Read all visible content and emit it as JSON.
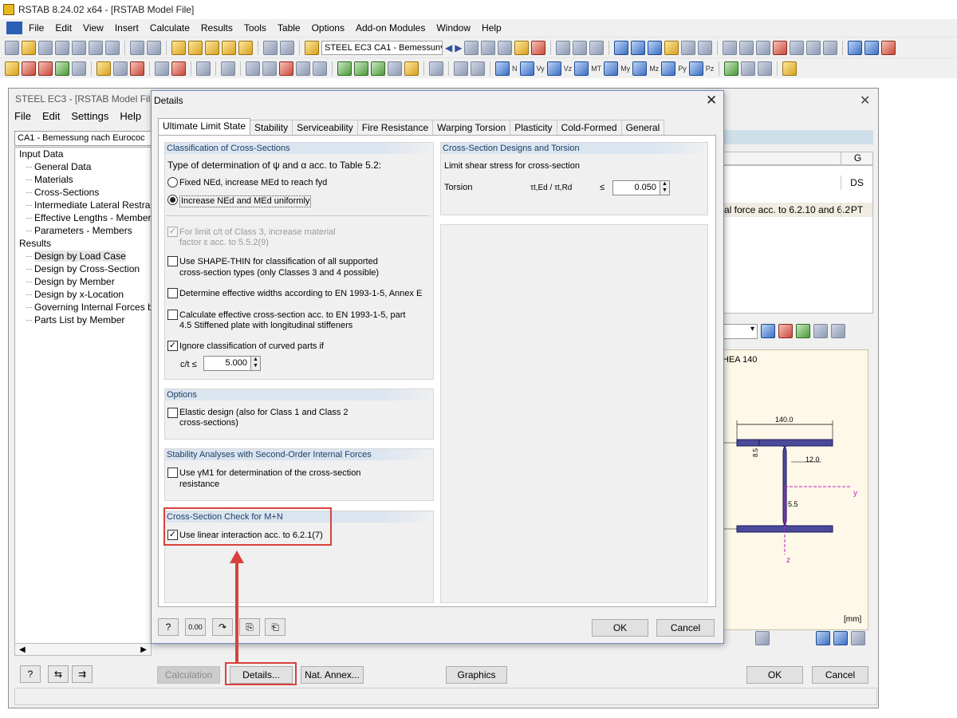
{
  "app": {
    "title": "RSTAB 8.24.02 x64 - [RSTAB Model File]",
    "menu": [
      "File",
      "Edit",
      "View",
      "Insert",
      "Calculate",
      "Results",
      "Tools",
      "Table",
      "Options",
      "Add-on Modules",
      "Window",
      "Help"
    ],
    "loadcase_combo": "STEEL EC3 CA1 - Bemessun",
    "toolbar_labels": [
      "N",
      "Vy",
      "Vz",
      "MT",
      "My",
      "Mz",
      "Py",
      "Pz"
    ]
  },
  "module": {
    "title": "STEEL EC3 - [RSTAB Model File]",
    "menu": [
      "File",
      "Edit",
      "Settings",
      "Help"
    ],
    "case_combo": "CA1 - Bemessung nach Eurococ",
    "tree": {
      "input_label": "Input Data",
      "input_items": [
        "General Data",
        "Materials",
        "Cross-Sections",
        "Intermediate Lateral Restraints",
        "Effective Lengths - Members",
        "Parameters - Members"
      ],
      "results_label": "Results",
      "result_items": [
        "Design by Load Case",
        "Design by Cross-Section",
        "Design by Member",
        "Design by x-Location",
        "Governing Internal Forces by Member",
        "Parts List by Member"
      ]
    },
    "grid": {
      "col_header": "G",
      "row1_code": "DS",
      "row2_text": "al force acc. to 6.2.10 and 6.2",
      "row2_code": "PT"
    },
    "section": {
      "name": "HEA 140",
      "dim_width": "140.0",
      "dim_flange": "8.5",
      "dim_radius": "12.0",
      "dim_web": "5.5",
      "axis_y": "y",
      "axis_z": "z",
      "unit": "[mm]"
    },
    "buttons": {
      "calculation": "Calculation",
      "details": "Details...",
      "nat_annex": "Nat. Annex...",
      "graphics": "Graphics",
      "ok": "OK",
      "cancel": "Cancel"
    }
  },
  "dialog": {
    "title": "Details",
    "tabs": [
      "Ultimate Limit State",
      "Stability",
      "Serviceability",
      "Fire Resistance",
      "Warping Torsion",
      "Plasticity",
      "Cold-Formed",
      "General"
    ],
    "classification": {
      "heading": "Classification of Cross-Sections",
      "type_label": "Type of determination of ψ and α acc. to Table 5.2:",
      "radio_fixed": "Fixed NEd, increase MEd to reach fyd",
      "radio_increase": "Increase NEd and MEd uniformly",
      "limit_c_t_line1": "For limit c/t of Class 3, increase material",
      "limit_c_t_line2": "factor ε acc. to 5.5.2(9)",
      "shape_thin_line1": "Use SHAPE-THIN for classification of all supported",
      "shape_thin_line2": "cross-section types (only Classes 3 and 4 possible)",
      "eff_widths": "Determine effective widths according to EN 1993-1-5, Annex E",
      "eff_section_line1": "Calculate effective cross-section acc. to EN 1993-1-5, part",
      "eff_section_line2": "4.5 Stiffened plate with longitudinal stiffeners",
      "ignore_curved": "Ignore classification of curved parts if",
      "ct_label": "c/t ≤",
      "ct_value": "5.000"
    },
    "options": {
      "heading": "Options",
      "elastic_line1": "Elastic design (also for Class 1 and Class 2",
      "elastic_line2": "cross-sections)"
    },
    "stability": {
      "heading": "Stability Analyses with Second-Order Internal Forces",
      "gamma_line1": "Use γM1 for determination of the cross-section",
      "gamma_line2": "resistance"
    },
    "mn_check": {
      "heading": "Cross-Section Check for M+N",
      "linear": "Use linear interaction acc. to 6.2.1(7)"
    },
    "torsion": {
      "heading": "Cross-Section Designs and Torsion",
      "limit_label": "Limit shear stress for cross-section",
      "torsion_label": "Torsion",
      "ratio": "τt,Ed / τt,Rd",
      "le": "≤",
      "value": "0.050"
    },
    "buttons": {
      "ok": "OK",
      "cancel": "Cancel"
    }
  },
  "colors": {
    "accent_red": "#d9413c",
    "group_header": "#dbe5f0",
    "section_fill": "#2b2b8c"
  }
}
